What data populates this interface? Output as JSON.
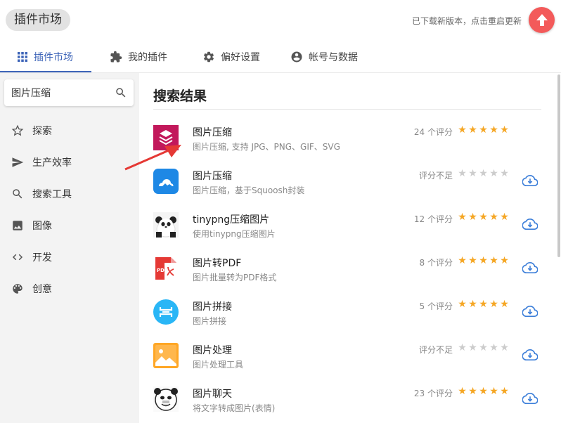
{
  "app": {
    "title": "插件市场",
    "update_text": "已下载新版本，点击重启更新",
    "accent_color": "#3d64b8",
    "update_color": "#f35a5a"
  },
  "tabs": [
    {
      "label": "插件市场",
      "icon": "grid-icon",
      "active": true
    },
    {
      "label": "我的插件",
      "icon": "puzzle-icon",
      "active": false
    },
    {
      "label": "偏好设置",
      "icon": "gear-icon",
      "active": false
    },
    {
      "label": "帐号与数据",
      "icon": "account-icon",
      "active": false
    }
  ],
  "search": {
    "value": "图片压缩",
    "placeholder": ""
  },
  "sidebar": {
    "items": [
      {
        "label": "探索",
        "icon": "star-outline-icon"
      },
      {
        "label": "生产效率",
        "icon": "send-icon"
      },
      {
        "label": "搜索工具",
        "icon": "search-icon"
      },
      {
        "label": "图像",
        "icon": "image-icon"
      },
      {
        "label": "开发",
        "icon": "code-icon"
      },
      {
        "label": "创意",
        "icon": "palette-icon"
      }
    ]
  },
  "main": {
    "title": "搜索结果",
    "results": [
      {
        "name": "图片压缩",
        "desc": "图片压缩, 支持 JPG、PNG、GIF、SVG",
        "rating_text": "24 个评分",
        "stars": 5,
        "downloadable": false,
        "icon": "layers-logo"
      },
      {
        "name": "图片压缩",
        "desc": "图片压缩，基于Squoosh封装",
        "rating_text": "评分不足",
        "stars": 0,
        "downloadable": true,
        "icon": "cloud-image-logo"
      },
      {
        "name": "tinypng压缩图片",
        "desc": "使用tinypng压缩图片",
        "rating_text": "12 个评分",
        "stars": 5,
        "downloadable": true,
        "icon": "panda-logo"
      },
      {
        "name": "图片转PDF",
        "desc": "图片批量转为PDF格式",
        "rating_text": "8 个评分",
        "stars": 5,
        "downloadable": true,
        "icon": "pdf-logo"
      },
      {
        "name": "图片拼接",
        "desc": "图片拼接",
        "rating_text": "5 个评分",
        "stars": 4.5,
        "downloadable": true,
        "icon": "stitch-logo"
      },
      {
        "name": "图片处理",
        "desc": "图片处理工具",
        "rating_text": "评分不足",
        "stars": 0,
        "downloadable": true,
        "icon": "landscape-logo"
      },
      {
        "name": "图片聊天",
        "desc": "将文字转成图片(表情)",
        "rating_text": "23 个评分",
        "stars": 5,
        "downloadable": true,
        "icon": "meme-face-logo"
      }
    ]
  }
}
